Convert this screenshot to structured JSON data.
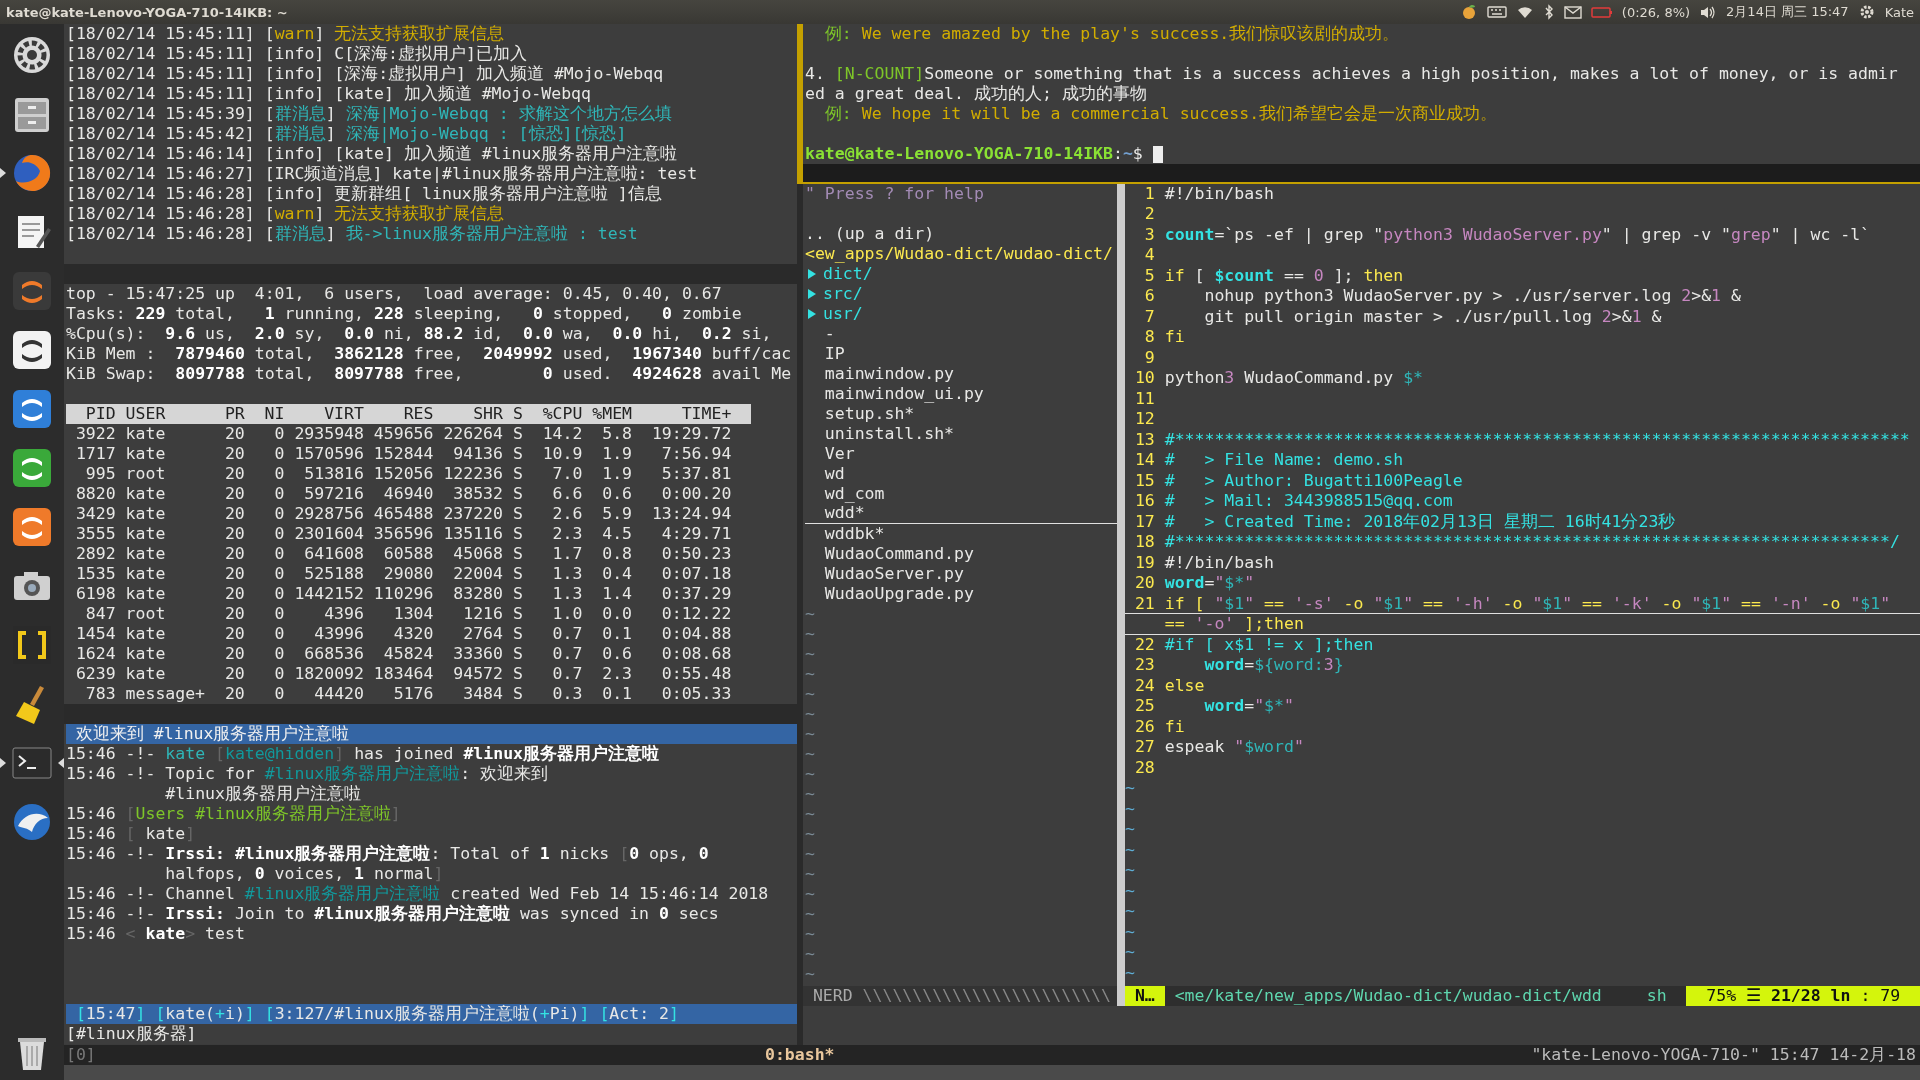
{
  "top_panel": {
    "window_title": "kate@kate-Lenovo-YOGA-710-14IKB: ~",
    "indicators": [
      {
        "kind": "fruit"
      },
      {
        "kind": "keyboard"
      },
      {
        "kind": "wifi"
      },
      {
        "kind": "bluetooth"
      },
      {
        "kind": "mail"
      },
      {
        "kind": "battery",
        "text": "(0:26, 8%)"
      },
      {
        "kind": "volume"
      },
      {
        "kind": "clock",
        "text": "2月14日 周三 15:47"
      },
      {
        "kind": "session",
        "text": "Kate"
      }
    ]
  },
  "launcher": [
    {
      "kind": "gear",
      "running": false,
      "selected": false
    },
    {
      "kind": "drawer",
      "running": false,
      "selected": false
    },
    {
      "kind": "globe",
      "running": true,
      "selected": false
    },
    {
      "kind": "notepad",
      "running": false,
      "selected": false
    },
    {
      "kind": "tile-dark",
      "running": false,
      "selected": false
    },
    {
      "kind": "tile-light",
      "running": false,
      "selected": false
    },
    {
      "kind": "tile-blue",
      "running": false,
      "selected": false
    },
    {
      "kind": "tile-green",
      "running": false,
      "selected": false
    },
    {
      "kind": "tile-orange",
      "running": false,
      "selected": false
    },
    {
      "kind": "camera",
      "running": false,
      "selected": false
    },
    {
      "kind": "brackets",
      "running": false,
      "selected": false
    },
    {
      "kind": "broom",
      "running": false,
      "selected": false
    },
    {
      "kind": "terminal",
      "running": true,
      "selected": true
    },
    {
      "kind": "bird",
      "running": false,
      "selected": false
    },
    {
      "kind": "trash",
      "running": false,
      "selected": false
    }
  ],
  "bridge_log": {
    "lines": [
      {
        "segments": [
          {
            "text": "[18/02/14 15:45:11] [",
            "kind": "plain"
          },
          {
            "text": "warn",
            "kind": "yellow"
          },
          {
            "text": "] ",
            "kind": "plain"
          },
          {
            "text": "无法支持获取扩展信息",
            "kind": "yellow"
          }
        ]
      },
      {
        "segments": [
          {
            "text": "[18/02/14 15:45:11] [info] C[深海:虚拟用户]已加入",
            "kind": "plain"
          }
        ]
      },
      {
        "segments": [
          {
            "text": "[18/02/14 15:45:11] [info] [深海:虚拟用户] 加入频道 #Mojo-Webqq",
            "kind": "plain"
          }
        ]
      },
      {
        "segments": [
          {
            "text": "[18/02/14 15:45:11] [info] [kate] 加入频道 #Mojo-Webqq",
            "kind": "plain"
          }
        ]
      },
      {
        "segments": [
          {
            "text": "[18/02/14 15:45:39] [",
            "kind": "plain"
          },
          {
            "text": "群消息",
            "kind": "cyan"
          },
          {
            "text": "] ",
            "kind": "plain"
          },
          {
            "text": "深海|Mojo-Webqq : 求解这个地方怎么填",
            "kind": "cyan"
          }
        ]
      },
      {
        "segments": [
          {
            "text": "[18/02/14 15:45:42] [",
            "kind": "plain"
          },
          {
            "text": "群消息",
            "kind": "cyan"
          },
          {
            "text": "] ",
            "kind": "plain"
          },
          {
            "text": "深海|Mojo-Webqq : [惊恐][惊恐]",
            "kind": "cyan"
          }
        ]
      },
      {
        "segments": [
          {
            "text": "[18/02/14 15:46:14] [info] [kate] 加入频道 #linux服务器用户注意啦",
            "kind": "plain"
          }
        ]
      },
      {
        "segments": [
          {
            "text": "[18/02/14 15:46:27] [IRC频道消息] kate|#linux服务器用户注意啦: test",
            "kind": "plain"
          }
        ]
      },
      {
        "segments": [
          {
            "text": "[18/02/14 15:46:28] [info] 更新群组[ linux服务器用户注意啦 ]信息",
            "kind": "plain"
          }
        ]
      },
      {
        "segments": [
          {
            "text": "[18/02/14 15:46:28] [",
            "kind": "plain"
          },
          {
            "text": "warn",
            "kind": "yellow"
          },
          {
            "text": "] ",
            "kind": "plain"
          },
          {
            "text": "无法支持获取扩展信息",
            "kind": "yellow"
          }
        ]
      },
      {
        "segments": [
          {
            "text": "[18/02/14 15:46:28] [",
            "kind": "plain"
          },
          {
            "text": "群消息",
            "kind": "cyan"
          },
          {
            "text": "] ",
            "kind": "plain"
          },
          {
            "text": "我->linux服务器用户注意啦 : test",
            "kind": "cyan"
          }
        ]
      }
    ]
  },
  "top": {
    "summary": [
      {
        "segments": [
          {
            "text": "top - 15:47:25 up  4:01,  6 users,  load average: 0.45, 0.40, 0.67",
            "kind": "plain"
          }
        ]
      },
      {
        "segments": [
          {
            "text": "Tasks: ",
            "kind": "plain"
          },
          {
            "text": "229",
            "kind": "bold"
          },
          {
            "text": " total,   ",
            "kind": "plain"
          },
          {
            "text": "1",
            "kind": "bold"
          },
          {
            "text": " running, ",
            "kind": "plain"
          },
          {
            "text": "228",
            "kind": "bold"
          },
          {
            "text": " sleeping,   ",
            "kind": "plain"
          },
          {
            "text": "0",
            "kind": "bold"
          },
          {
            "text": " stopped,   ",
            "kind": "plain"
          },
          {
            "text": "0",
            "kind": "bold"
          },
          {
            "text": " zombie",
            "kind": "plain"
          }
        ]
      },
      {
        "segments": [
          {
            "text": "%Cpu(s):  ",
            "kind": "plain"
          },
          {
            "text": "9.6",
            "kind": "bold"
          },
          {
            "text": " us,  ",
            "kind": "plain"
          },
          {
            "text": "2.0",
            "kind": "bold"
          },
          {
            "text": " sy,  ",
            "kind": "plain"
          },
          {
            "text": "0.0",
            "kind": "bold"
          },
          {
            "text": " ni, ",
            "kind": "plain"
          },
          {
            "text": "88.2",
            "kind": "bold"
          },
          {
            "text": " id,  ",
            "kind": "plain"
          },
          {
            "text": "0.0",
            "kind": "bold"
          },
          {
            "text": " wa,  ",
            "kind": "plain"
          },
          {
            "text": "0.0",
            "kind": "bold"
          },
          {
            "text": " hi,  ",
            "kind": "plain"
          },
          {
            "text": "0.2",
            "kind": "bold"
          },
          {
            "text": " si,",
            "kind": "plain"
          }
        ]
      },
      {
        "segments": [
          {
            "text": "KiB Mem :  ",
            "kind": "plain"
          },
          {
            "text": "7879460",
            "kind": "bold"
          },
          {
            "text": " total,  ",
            "kind": "plain"
          },
          {
            "text": "3862128",
            "kind": "bold"
          },
          {
            "text": " free,  ",
            "kind": "plain"
          },
          {
            "text": "2049992",
            "kind": "bold"
          },
          {
            "text": " used,  ",
            "kind": "plain"
          },
          {
            "text": "1967340",
            "kind": "bold"
          },
          {
            "text": " buff/cac",
            "kind": "plain"
          }
        ]
      },
      {
        "segments": [
          {
            "text": "KiB Swap:  ",
            "kind": "plain"
          },
          {
            "text": "8097788",
            "kind": "bold"
          },
          {
            "text": " total,  ",
            "kind": "plain"
          },
          {
            "text": "8097788",
            "kind": "bold"
          },
          {
            "text": " free,        ",
            "kind": "plain"
          },
          {
            "text": "0",
            "kind": "bold"
          },
          {
            "text": " used.  ",
            "kind": "plain"
          },
          {
            "text": "4924628",
            "kind": "bold"
          },
          {
            "text": " avail Me",
            "kind": "plain"
          }
        ]
      }
    ],
    "columns": [
      "PID",
      "USER",
      "PR",
      "NI",
      "VIRT",
      "RES",
      "SHR",
      "S",
      "%CPU",
      "%MEM",
      "TIME+"
    ],
    "rows": [
      [
        "3922",
        "kate",
        "20",
        "0",
        "2935948",
        "459656",
        "226264",
        "S",
        "14.2",
        "5.8",
        "19:29.72"
      ],
      [
        "1717",
        "kate",
        "20",
        "0",
        "1570596",
        "152844",
        "94136",
        "S",
        "10.9",
        "1.9",
        "7:56.94"
      ],
      [
        "995",
        "root",
        "20",
        "0",
        "513816",
        "152056",
        "122236",
        "S",
        "7.0",
        "1.9",
        "5:37.81"
      ],
      [
        "8820",
        "kate",
        "20",
        "0",
        "597216",
        "46940",
        "38532",
        "S",
        "6.6",
        "0.6",
        "0:00.20"
      ],
      [
        "3429",
        "kate",
        "20",
        "0",
        "2928756",
        "465488",
        "237220",
        "S",
        "2.6",
        "5.9",
        "13:24.94"
      ],
      [
        "3555",
        "kate",
        "20",
        "0",
        "2301604",
        "356596",
        "135116",
        "S",
        "2.3",
        "4.5",
        "4:29.71"
      ],
      [
        "2892",
        "kate",
        "20",
        "0",
        "641608",
        "60588",
        "45068",
        "S",
        "1.7",
        "0.8",
        "0:50.23"
      ],
      [
        "1535",
        "kate",
        "20",
        "0",
        "525188",
        "29080",
        "22004",
        "S",
        "1.3",
        "0.4",
        "0:07.18"
      ],
      [
        "6198",
        "kate",
        "20",
        "0",
        "1442152",
        "110296",
        "83280",
        "S",
        "1.3",
        "1.4",
        "0:37.29"
      ],
      [
        "847",
        "root",
        "20",
        "0",
        "4396",
        "1304",
        "1216",
        "S",
        "1.0",
        "0.0",
        "0:12.22"
      ],
      [
        "1454",
        "kate",
        "20",
        "0",
        "43996",
        "4320",
        "2764",
        "S",
        "0.7",
        "0.1",
        "0:04.88"
      ],
      [
        "1624",
        "kate",
        "20",
        "0",
        "668536",
        "45824",
        "33360",
        "S",
        "0.7",
        "0.6",
        "0:08.68"
      ],
      [
        "6239",
        "kate",
        "20",
        "0",
        "1820092",
        "183464",
        "94572",
        "S",
        "0.7",
        "2.3",
        "0:55.48"
      ],
      [
        "783",
        "message+",
        "20",
        "0",
        "44420",
        "5176",
        "3484",
        "S",
        "0.3",
        "0.1",
        "0:05.33"
      ]
    ]
  },
  "irssi": {
    "topic": "欢迎来到 #linux服务器用户注意啦",
    "lines": [
      {
        "continued": false,
        "segments": [
          {
            "text": "15:46 -!- ",
            "kind": "plain"
          },
          {
            "text": "kate",
            "kind": "cyan"
          },
          {
            "text": " [",
            "kind": "dim"
          },
          {
            "text": "kate@hidden",
            "kind": "darkcyan"
          },
          {
            "text": "] ",
            "kind": "dim"
          },
          {
            "text": "has joined ",
            "kind": "plain"
          },
          {
            "text": "#linux服务器用户注意啦",
            "kind": "bold"
          }
        ]
      },
      {
        "continued": false,
        "segments": [
          {
            "text": "15:46 -!- Topic for ",
            "kind": "plain"
          },
          {
            "text": "#linux服务器用户注意啦",
            "kind": "darkcyan"
          },
          {
            "text": ": 欢迎来到",
            "kind": "plain"
          }
        ]
      },
      {
        "continued": true,
        "segments": [
          {
            "text": "#linux服务器用户注意啦",
            "kind": "plain"
          }
        ]
      },
      {
        "continued": false,
        "segments": [
          {
            "text": "15:46 ",
            "kind": "plain"
          },
          {
            "text": "[",
            "kind": "dim"
          },
          {
            "text": "Users ",
            "kind": "green"
          },
          {
            "text": "#linux服务器用户注意啦",
            "kind": "green"
          },
          {
            "text": "]",
            "kind": "dim"
          }
        ]
      },
      {
        "continued": false,
        "segments": [
          {
            "text": "15:46 ",
            "kind": "plain"
          },
          {
            "text": "[",
            "kind": "dim"
          },
          {
            "text": " kate",
            "kind": "plain"
          },
          {
            "text": "]",
            "kind": "dim"
          }
        ]
      },
      {
        "continued": false,
        "segments": [
          {
            "text": "15:46 -!- ",
            "kind": "plain"
          },
          {
            "text": "Irssi: #linux服务器用户注意啦",
            "kind": "bold"
          },
          {
            "text": ": Total of ",
            "kind": "plain"
          },
          {
            "text": "1",
            "kind": "bold"
          },
          {
            "text": " nicks ",
            "kind": "plain"
          },
          {
            "text": "[",
            "kind": "dim"
          },
          {
            "text": "0",
            "kind": "bold"
          },
          {
            "text": " ops, ",
            "kind": "plain"
          },
          {
            "text": "0",
            "kind": "bold"
          }
        ]
      },
      {
        "continued": true,
        "segments": [
          {
            "text": "halfops, ",
            "kind": "plain"
          },
          {
            "text": "0",
            "kind": "bold"
          },
          {
            "text": " voices, ",
            "kind": "plain"
          },
          {
            "text": "1",
            "kind": "bold"
          },
          {
            "text": " normal",
            "kind": "plain"
          },
          {
            "text": "]",
            "kind": "dim"
          }
        ]
      },
      {
        "continued": false,
        "segments": [
          {
            "text": "15:46 -!- Channel ",
            "kind": "plain"
          },
          {
            "text": "#linux服务器用户注意啦",
            "kind": "darkcyan"
          },
          {
            "text": " created Wed Feb 14 15:46:14 2018",
            "kind": "plain"
          }
        ]
      },
      {
        "continued": false,
        "segments": [
          {
            "text": "15:46 -!- ",
            "kind": "plain"
          },
          {
            "text": "Irssi:",
            "kind": "bold"
          },
          {
            "text": " Join to ",
            "kind": "plain"
          },
          {
            "text": "#linux服务器用户注意啦",
            "kind": "bold"
          },
          {
            "text": " was synced in ",
            "kind": "plain"
          },
          {
            "text": "0",
            "kind": "bold"
          },
          {
            "text": " secs",
            "kind": "plain"
          }
        ]
      },
      {
        "continued": false,
        "segments": [
          {
            "text": "15:46 ",
            "kind": "plain"
          },
          {
            "text": "<",
            "kind": "dim"
          },
          {
            "text": " kate",
            "kind": "bold"
          },
          {
            "text": ">",
            "kind": "dim"
          },
          {
            "text": " test",
            "kind": "plain"
          }
        ]
      }
    ],
    "status": [
      {
        "text": "[",
        "kind": "cyan"
      },
      {
        "text": "15:47",
        "kind": "plain"
      },
      {
        "text": "] [",
        "kind": "cyan"
      },
      {
        "text": "kate(",
        "kind": "plain"
      },
      {
        "text": "+",
        "kind": "cyan"
      },
      {
        "text": "i)",
        "kind": "plain"
      },
      {
        "text": "] [",
        "kind": "cyan"
      },
      {
        "text": "3:127/#linux服务器用户注意啦(",
        "kind": "plain"
      },
      {
        "text": "+",
        "kind": "cyan"
      },
      {
        "text": "Pi)",
        "kind": "plain"
      },
      {
        "text": "] [",
        "kind": "cyan"
      },
      {
        "text": "Act: 2",
        "kind": "plain"
      },
      {
        "text": "]",
        "kind": "cyan"
      }
    ],
    "input_prompt": "[#linux服务器]"
  },
  "dictionary": {
    "blocks": [
      [
        {
          "segments": [
            {
              "text": "  例:",
              "kind": "green"
            },
            {
              "text": " We were amazed by the play's success.我们惊叹该剧的成功。",
              "kind": "yellow"
            }
          ]
        }
      ],
      [
        {
          "segments": [
            {
              "text": "4. ",
              "kind": "plain"
            },
            {
              "text": "[N-COUNT]",
              "kind": "green"
            },
            {
              "text": "Someone or something that is a success achieves a high position, makes a lot of money, or is admir",
              "kind": "plain"
            }
          ]
        },
        {
          "segments": [
            {
              "text": "ed a great deal. 成功的人; 成功的事物",
              "kind": "plain"
            }
          ]
        },
        {
          "segments": [
            {
              "text": "  例:",
              "kind": "green"
            },
            {
              "text": " We hope it will be a commercial success.我们希望它会是一次商业成功。",
              "kind": "yellow"
            }
          ]
        }
      ]
    ],
    "prompt": {
      "cursor": true,
      "segments": [
        {
          "text": "kate@kate-Lenovo-YOGA-710-14IKB",
          "kind": "boldgreen"
        },
        {
          "text": ":",
          "kind": "plain"
        },
        {
          "text": "~",
          "kind": "boldblue"
        },
        {
          "text": "$",
          "kind": "plain"
        }
      ]
    }
  },
  "nerd_tree": {
    "help": "\" Press ? for help",
    "up_dir": ".. (up a dir)",
    "root": {
      "name": "<ew_apps/Wudao-dict/wudao-dict/",
      "children": [
        {
          "name": "dict/",
          "kind": "dir",
          "expanded": false,
          "cursor": false
        },
        {
          "name": "src/",
          "kind": "dir",
          "expanded": false,
          "cursor": false
        },
        {
          "name": "usr/",
          "kind": "dir",
          "expanded": false,
          "cursor": false
        },
        {
          "name": "-",
          "kind": "file",
          "cursor": false
        },
        {
          "name": "IP",
          "kind": "file",
          "cursor": false
        },
        {
          "name": "mainwindow.py",
          "kind": "file",
          "cursor": false
        },
        {
          "name": "mainwindow_ui.py",
          "kind": "file",
          "cursor": false
        },
        {
          "name": "setup.sh*",
          "kind": "file",
          "cursor": false
        },
        {
          "name": "uninstall.sh*",
          "kind": "file",
          "cursor": false
        },
        {
          "name": "Ver",
          "kind": "file",
          "cursor": false
        },
        {
          "name": "wd",
          "kind": "file",
          "cursor": false
        },
        {
          "name": "wd_com",
          "kind": "file",
          "cursor": false
        },
        {
          "name": "wdd*",
          "kind": "file",
          "cursor": true
        },
        {
          "name": "wddbk*",
          "kind": "file",
          "cursor": false
        },
        {
          "name": "WudaoCommand.py",
          "kind": "file",
          "cursor": false
        },
        {
          "name": "WudaoServer.py",
          "kind": "file",
          "cursor": false
        },
        {
          "name": "WudaoUpgrade.py",
          "kind": "file",
          "cursor": false
        }
      ]
    },
    "filler": [
      "~",
      "~",
      "~",
      "~",
      "~",
      "~",
      "~",
      "~",
      "~",
      "~",
      "~",
      "~",
      "~",
      "~",
      "~",
      "~",
      "~",
      "~",
      "~"
    ],
    "status": "NERD",
    "status_fill": "\\\\\\\\\\\\\\\\\\\\\\\\\\\\\\\\\\\\\\\\\\\\\\\\\\"
  },
  "editor": {
    "lines": [
      {
        "number": "1",
        "cursor": false,
        "segments": [
          {
            "text": "#!/bin/bash",
            "kind": "plain"
          }
        ]
      },
      {
        "number": "2",
        "cursor": false
      },
      {
        "number": "3",
        "cursor": false,
        "segments": [
          {
            "text": "count",
            "kind": "var"
          },
          {
            "text": "=`ps -ef | grep \"",
            "kind": "plain"
          },
          {
            "text": "python3 WudaoServer.py",
            "kind": "string"
          },
          {
            "text": "\" | grep -v \"",
            "kind": "plain"
          },
          {
            "text": "grep",
            "kind": "string"
          },
          {
            "text": "\" | wc -l`",
            "kind": "plain"
          }
        ]
      },
      {
        "number": "4",
        "cursor": false
      },
      {
        "number": "5",
        "cursor": false,
        "segments": [
          {
            "text": "if",
            "kind": "keyword"
          },
          {
            "text": " [ ",
            "kind": "plain"
          },
          {
            "text": "$count",
            "kind": "var"
          },
          {
            "text": " == ",
            "kind": "plain"
          },
          {
            "text": "0",
            "kind": "number"
          },
          {
            "text": " ]; ",
            "kind": "plain"
          },
          {
            "text": "then",
            "kind": "keyword"
          }
        ]
      },
      {
        "number": "6",
        "cursor": false,
        "segments": [
          {
            "text": "    nohup python3 WudaoServer.py > ./usr/server.log ",
            "kind": "plain"
          },
          {
            "text": "2",
            "kind": "number"
          },
          {
            "text": ">&",
            "kind": "plain"
          },
          {
            "text": "1",
            "kind": "number"
          },
          {
            "text": " &",
            "kind": "plain"
          }
        ]
      },
      {
        "number": "7",
        "cursor": false,
        "segments": [
          {
            "text": "    git pull origin master > ./usr/pull.log ",
            "kind": "plain"
          },
          {
            "text": "2",
            "kind": "number"
          },
          {
            "text": ">&",
            "kind": "plain"
          },
          {
            "text": "1",
            "kind": "number"
          },
          {
            "text": " &",
            "kind": "plain"
          }
        ]
      },
      {
        "number": "8",
        "cursor": false,
        "segments": [
          {
            "text": "fi",
            "kind": "keyword"
          }
        ]
      },
      {
        "number": "9",
        "cursor": false
      },
      {
        "number": "10",
        "cursor": false,
        "segments": [
          {
            "text": "python",
            "kind": "plain"
          },
          {
            "text": "3",
            "kind": "number"
          },
          {
            "text": " WudaoCommand.py ",
            "kind": "plain"
          },
          {
            "text": "$*",
            "kind": "cyan"
          }
        ]
      },
      {
        "number": "11",
        "cursor": false
      },
      {
        "number": "12",
        "cursor": false
      },
      {
        "number": "13",
        "cursor": false,
        "segments": [
          {
            "text": "#**************************************************************************",
            "kind": "comment"
          }
        ]
      },
      {
        "number": "14",
        "cursor": false,
        "segments": [
          {
            "text": "#   > File Name: demo.sh",
            "kind": "comment"
          }
        ]
      },
      {
        "number": "15",
        "cursor": false,
        "segments": [
          {
            "text": "#   > Author: Bugatti100Peagle",
            "kind": "comment"
          }
        ]
      },
      {
        "number": "16",
        "cursor": false,
        "segments": [
          {
            "text": "#   > Mail: 3443988515@qq.com",
            "kind": "comment"
          }
        ]
      },
      {
        "number": "17",
        "cursor": false,
        "segments": [
          {
            "text": "#   > Created Time: 2018年02月13日 星期二 16时41分23秒",
            "kind": "comment"
          }
        ]
      },
      {
        "number": "18",
        "cursor": false,
        "segments": [
          {
            "text": "#************************************************************************/",
            "kind": "comment"
          }
        ]
      },
      {
        "number": "19",
        "cursor": false,
        "segments": [
          {
            "text": "#!/bin/bash",
            "kind": "plain"
          }
        ]
      },
      {
        "number": "20",
        "cursor": false,
        "segments": [
          {
            "text": "word",
            "kind": "var"
          },
          {
            "text": "=",
            "kind": "plain"
          },
          {
            "text": "\"",
            "kind": "string"
          },
          {
            "text": "$*",
            "kind": "cyan"
          },
          {
            "text": "\"",
            "kind": "string"
          }
        ]
      },
      {
        "number": "21",
        "cursor": true,
        "segments": [
          {
            "text": "if [ ",
            "kind": "keyword"
          },
          {
            "text": "\"",
            "kind": "string"
          },
          {
            "text": "$1",
            "kind": "cyan"
          },
          {
            "text": "\"",
            "kind": "string"
          },
          {
            "text": " == ",
            "kind": "keyword"
          },
          {
            "text": "'-s'",
            "kind": "string"
          },
          {
            "text": " -o ",
            "kind": "keyword"
          },
          {
            "text": "\"",
            "kind": "string"
          },
          {
            "text": "$1",
            "kind": "cyan"
          },
          {
            "text": "\"",
            "kind": "string"
          },
          {
            "text": " == ",
            "kind": "keyword"
          },
          {
            "text": "'-h'",
            "kind": "string"
          },
          {
            "text": " -o ",
            "kind": "keyword"
          },
          {
            "text": "\"",
            "kind": "string"
          },
          {
            "text": "$1",
            "kind": "cyan"
          },
          {
            "text": "\"",
            "kind": "string"
          },
          {
            "text": " == ",
            "kind": "keyword"
          },
          {
            "text": "'-k'",
            "kind": "string"
          },
          {
            "text": " -o ",
            "kind": "keyword"
          },
          {
            "text": "\"",
            "kind": "string"
          },
          {
            "text": "$1",
            "kind": "cyan"
          },
          {
            "text": "\"",
            "kind": "string"
          },
          {
            "text": " == ",
            "kind": "keyword"
          },
          {
            "text": "'-n'",
            "kind": "string"
          },
          {
            "text": " -o ",
            "kind": "keyword"
          },
          {
            "text": "\"",
            "kind": "string"
          },
          {
            "text": "$1",
            "kind": "cyan"
          },
          {
            "text": "\"",
            "kind": "string"
          }
        ],
        "wrap": [
          {
            "text": "== ",
            "kind": "keyword"
          },
          {
            "text": "'-o'",
            "kind": "string"
          },
          {
            "text": " ];then",
            "kind": "keyword"
          }
        ]
      },
      {
        "number": "22",
        "cursor": false,
        "segments": [
          {
            "text": "#if [ x$1 != x ];then",
            "kind": "comment"
          }
        ]
      },
      {
        "number": "23",
        "cursor": false,
        "segments": [
          {
            "text": "    word",
            "kind": "var"
          },
          {
            "text": "=",
            "kind": "plain"
          },
          {
            "text": "${word:",
            "kind": "cyan"
          },
          {
            "text": "3",
            "kind": "number"
          },
          {
            "text": "}",
            "kind": "cyan"
          }
        ]
      },
      {
        "number": "24",
        "cursor": false,
        "segments": [
          {
            "text": "else",
            "kind": "keyword"
          }
        ]
      },
      {
        "number": "25",
        "cursor": false,
        "segments": [
          {
            "text": "    word",
            "kind": "var"
          },
          {
            "text": "=",
            "kind": "plain"
          },
          {
            "text": "\"",
            "kind": "string"
          },
          {
            "text": "$*",
            "kind": "cyan"
          },
          {
            "text": "\"",
            "kind": "string"
          }
        ]
      },
      {
        "number": "26",
        "cursor": false,
        "segments": [
          {
            "text": "fi",
            "kind": "keyword"
          }
        ]
      },
      {
        "number": "27",
        "cursor": false,
        "segments": [
          {
            "text": "espeak ",
            "kind": "plain"
          },
          {
            "text": "\"",
            "kind": "string"
          },
          {
            "text": "$word",
            "kind": "cyan"
          },
          {
            "text": "\"",
            "kind": "string"
          }
        ]
      },
      {
        "number": "28",
        "cursor": false
      }
    ],
    "filler": [
      "~",
      "~",
      "~",
      "~",
      "~",
      "~",
      "~",
      "~",
      "~",
      "~"
    ],
    "status": {
      "mode": "N…",
      "path": "<me/kate/new_apps/Wudao-dict/wudao-dict/wdd",
      "filetype": "sh",
      "position": "75% ☰ **21/28 ln** : 79"
    }
  },
  "tmux_status": {
    "session": "[0]",
    "window": "0:bash*",
    "right": "\"kate-Lenovo-YOGA-710-\" 15:47 14-2月-18"
  }
}
